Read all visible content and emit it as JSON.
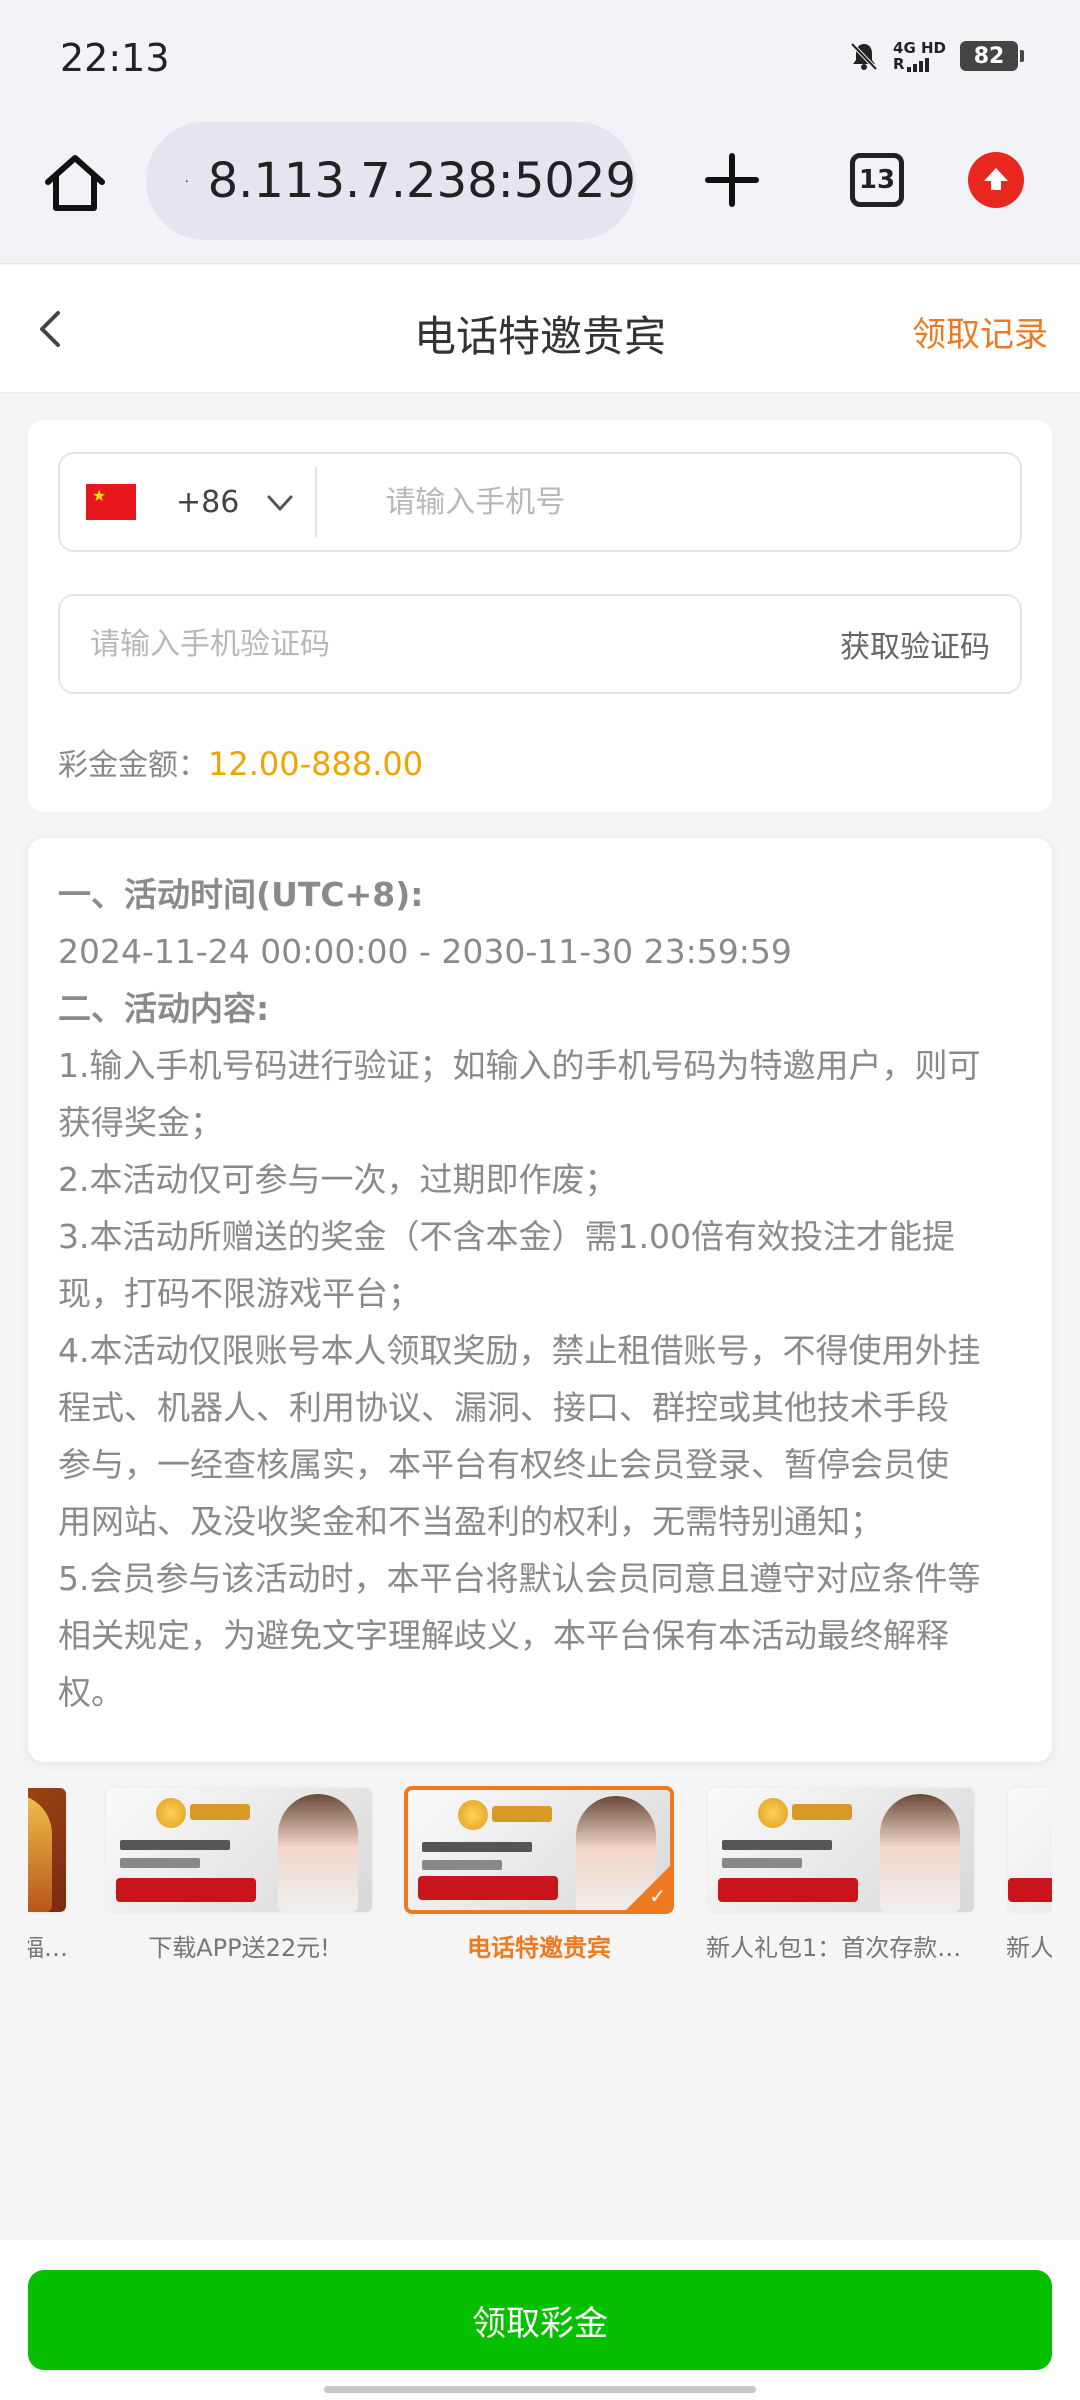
{
  "status_bar": {
    "time": "22:13",
    "network": "4G HD",
    "signal": "R",
    "battery": "82"
  },
  "browser": {
    "url": "8.113.7.238:5029",
    "tab_count": "13"
  },
  "header": {
    "title": "电话特邀贵宾",
    "records_label": "领取记录"
  },
  "form": {
    "country_code": "+86",
    "phone_placeholder": "请输入手机号",
    "code_placeholder": "请输入手机验证码",
    "get_code_label": "获取验证码",
    "bonus_label": "彩金金额：",
    "bonus_value": "12.00-888.00"
  },
  "rules": {
    "lines": [
      {
        "text": "一、活动时间(UTC+8):",
        "bold": true
      },
      {
        "text": "2024-11-24 00:00:00 - 2030-11-30 23:59:59",
        "bold": false
      },
      {
        "text": "二、活动内容:",
        "bold": true
      },
      {
        "text": "1.输入手机号码进行验证；如输入的手机号码为特邀用户，则可",
        "bold": false
      },
      {
        "text": "获得奖金；",
        "bold": false
      },
      {
        "text": "2.本活动仅可参与一次，过期即作废；",
        "bold": false
      },
      {
        "text": "3.本活动所赠送的奖金（不含本金）需1.00倍有效投注才能提",
        "bold": false
      },
      {
        "text": "现，打码不限游戏平台；",
        "bold": false
      },
      {
        "text": "4.本活动仅限账号本人领取奖励，禁止租借账号，不得使用外挂",
        "bold": false
      },
      {
        "text": "程式、机器人、利用协议、漏洞、接口、群控或其他技术手段",
        "bold": false
      },
      {
        "text": "参与，一经查核属实，本平台有权终止会员登录、暂停会员使",
        "bold": false
      },
      {
        "text": "用网站、及没收奖金和不当盈利的权利，无需特别通知；",
        "bold": false
      },
      {
        "text": "5.会员参与该活动时，本平台将默认会员同意且遵守对应条件等",
        "bold": false
      },
      {
        "text": "相关规定，为避免文字理解歧义，本平台保有本活动最终解释",
        "bold": false
      },
      {
        "text": "权。",
        "bold": false
      }
    ]
  },
  "banners": [
    {
      "label": "福…",
      "active": false
    },
    {
      "label": "下载APP送22元!",
      "active": false
    },
    {
      "label": "电话特邀贵宾",
      "active": true
    },
    {
      "label": "新人礼包1：首次存款1…",
      "active": false
    },
    {
      "label": "新人",
      "active": false
    }
  ],
  "footer": {
    "claim_label": "领取彩金"
  },
  "colors": {
    "accent": "#ed7a21",
    "bonus": "#f0a400",
    "claim_button": "#06c000"
  }
}
